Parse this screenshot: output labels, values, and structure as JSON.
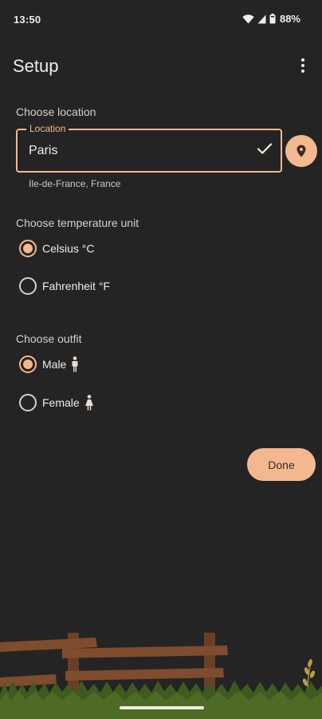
{
  "status_bar": {
    "time": "13:50",
    "battery": "88%",
    "icons": [
      "wifi-icon",
      "cell-signal-icon",
      "battery-icon"
    ]
  },
  "app_bar": {
    "title": "Setup",
    "overflow_icon": "more-vert-icon"
  },
  "location": {
    "section_label": "Choose location",
    "field_label": "Location",
    "value": "Paris",
    "subtext": "Ile-de-France, France",
    "valid_icon": "check-icon",
    "pin_icon": "location-pin-icon"
  },
  "temperature": {
    "section_label": "Choose temperature unit",
    "options": [
      {
        "label": "Celsius °C",
        "selected": true
      },
      {
        "label": "Fahrenheit °F",
        "selected": false
      }
    ]
  },
  "outfit": {
    "section_label": "Choose outfit",
    "options": [
      {
        "label": "Male",
        "icon": "male-icon",
        "selected": true
      },
      {
        "label": "Female",
        "icon": "female-icon",
        "selected": false
      }
    ]
  },
  "actions": {
    "done_label": "Done"
  },
  "colors": {
    "background": "#242424",
    "accent": "#f4b891",
    "text": "#f2ece6",
    "fence": "#7a4a2c",
    "grass": "#3f5a1e"
  }
}
